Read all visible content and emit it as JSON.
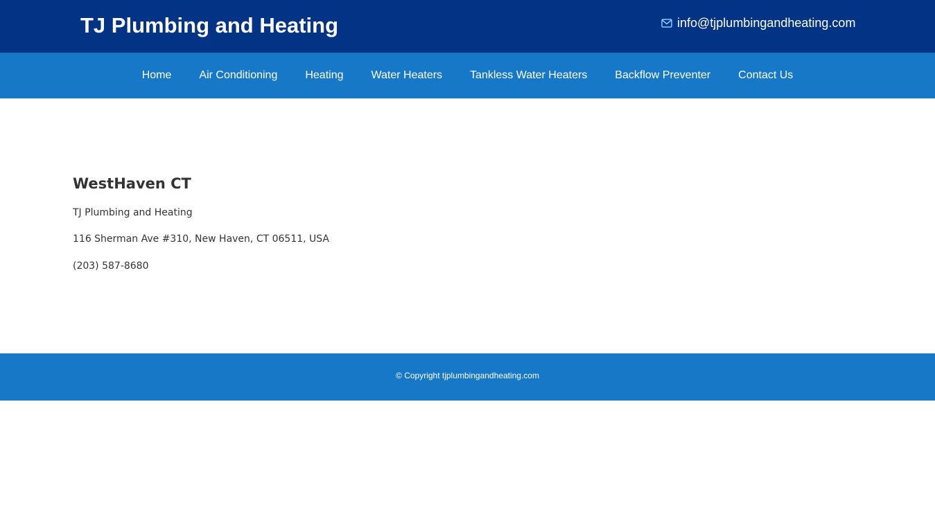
{
  "header": {
    "site_title": "TJ Plumbing and Heating",
    "email": "info@tjplumbingandheating.com",
    "email_icon": "envelope-icon"
  },
  "nav": {
    "items": [
      {
        "label": "Home"
      },
      {
        "label": "Air Conditioning"
      },
      {
        "label": "Heating"
      },
      {
        "label": "Water Heaters"
      },
      {
        "label": "Tankless Water Heaters"
      },
      {
        "label": "Backflow Preventer"
      },
      {
        "label": "Contact Us"
      }
    ]
  },
  "main": {
    "heading": "WestHaven CT",
    "business_name": "TJ Plumbing and Heating",
    "address": "116 Sherman Ave #310, New Haven, CT 06511, USA",
    "phone": "(203) 587-8680"
  },
  "footer": {
    "copyright": "© Copyright tjplumbingandheating.com"
  },
  "colors": {
    "topbar": "#033385",
    "navbar": "#1778c8",
    "footer": "#1778c8",
    "text": "#333333",
    "icon_accent": "#8ec6ff"
  }
}
